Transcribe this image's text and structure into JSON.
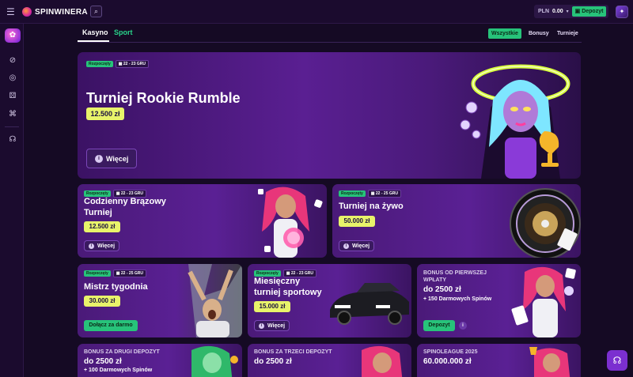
{
  "header": {
    "menu_icon": "hamburger-icon",
    "logo_text": "SPINWINERA",
    "search_icon": "search-icon",
    "wallet_currency": "PLN",
    "wallet_amount": "0.00",
    "deposit_label": "Depozyt",
    "avatar_icon": "user-avatar-icon"
  },
  "sidebar": {
    "items": [
      "promo-icon",
      "sports-icon",
      "casino-chip-icon",
      "dice-icon",
      "gamepad-icon",
      "support-icon"
    ]
  },
  "tabs": {
    "kasyno": "Kasyno",
    "sport": "Sport"
  },
  "filters": {
    "all": "Wszystkie",
    "bonusy": "Bonusy",
    "turnieje": "Turnieje"
  },
  "hero": {
    "badge_live": "Rozpoczęty",
    "badge_date": "22 - 23 GRU",
    "title": "Turniej Rookie Rumble",
    "prize": "12.500 zł",
    "more": "Więcej"
  },
  "cards": {
    "bronze": {
      "badge_live": "Rozpoczęty",
      "badge_date": "22 - 23 GRU",
      "title_line1": "Codzienny Brązowy",
      "title_line2": "Turniej",
      "prize": "12.500 zł",
      "more": "Więcej"
    },
    "live": {
      "badge_live": "Rozpoczęty",
      "badge_date": "22 - 25 GRU",
      "title": "Turniej na żywo",
      "prize": "50.000 zł",
      "more": "Więcej"
    },
    "master": {
      "badge_live": "Rozpoczęty",
      "badge_date": "22 - 25 GRU",
      "title": "Mistrz tygodnia",
      "prize": "30.000 zł",
      "join": "Dołącz za darmo"
    },
    "sport": {
      "badge_live": "Rozpoczęty",
      "badge_date": "22 - 23 GRU",
      "title_line1": "Miesięczny",
      "title_line2": "turniej sportowy",
      "prize": "15.000 zł",
      "more": "Więcej"
    },
    "first_deposit": {
      "line1": "BONUS OD PIERWSZEJ",
      "line2": "WPŁATY",
      "amount": "do 2500 zł",
      "spins": "+ 150 Darmowych Spinów",
      "button": "Depozyt"
    },
    "second_deposit": {
      "line1": "BONUS ZA DRUGI DEPOZYT",
      "amount": "do 2500 zł",
      "spins": "+ 100 Darmowych Spinów"
    },
    "third_deposit": {
      "line1": "BONUS ZA TRZECI DEPOZYT",
      "amount": "do 2500 zł"
    },
    "league": {
      "line1": "SPINOLEAGUE 2025",
      "amount": "60.000.000 zł"
    }
  },
  "support_icon": "chat-support-icon",
  "colors": {
    "accent_green": "#27c37a",
    "prize_yellow": "#e8f36a",
    "bg": "#150a24",
    "card_purple": "#5a2094"
  }
}
